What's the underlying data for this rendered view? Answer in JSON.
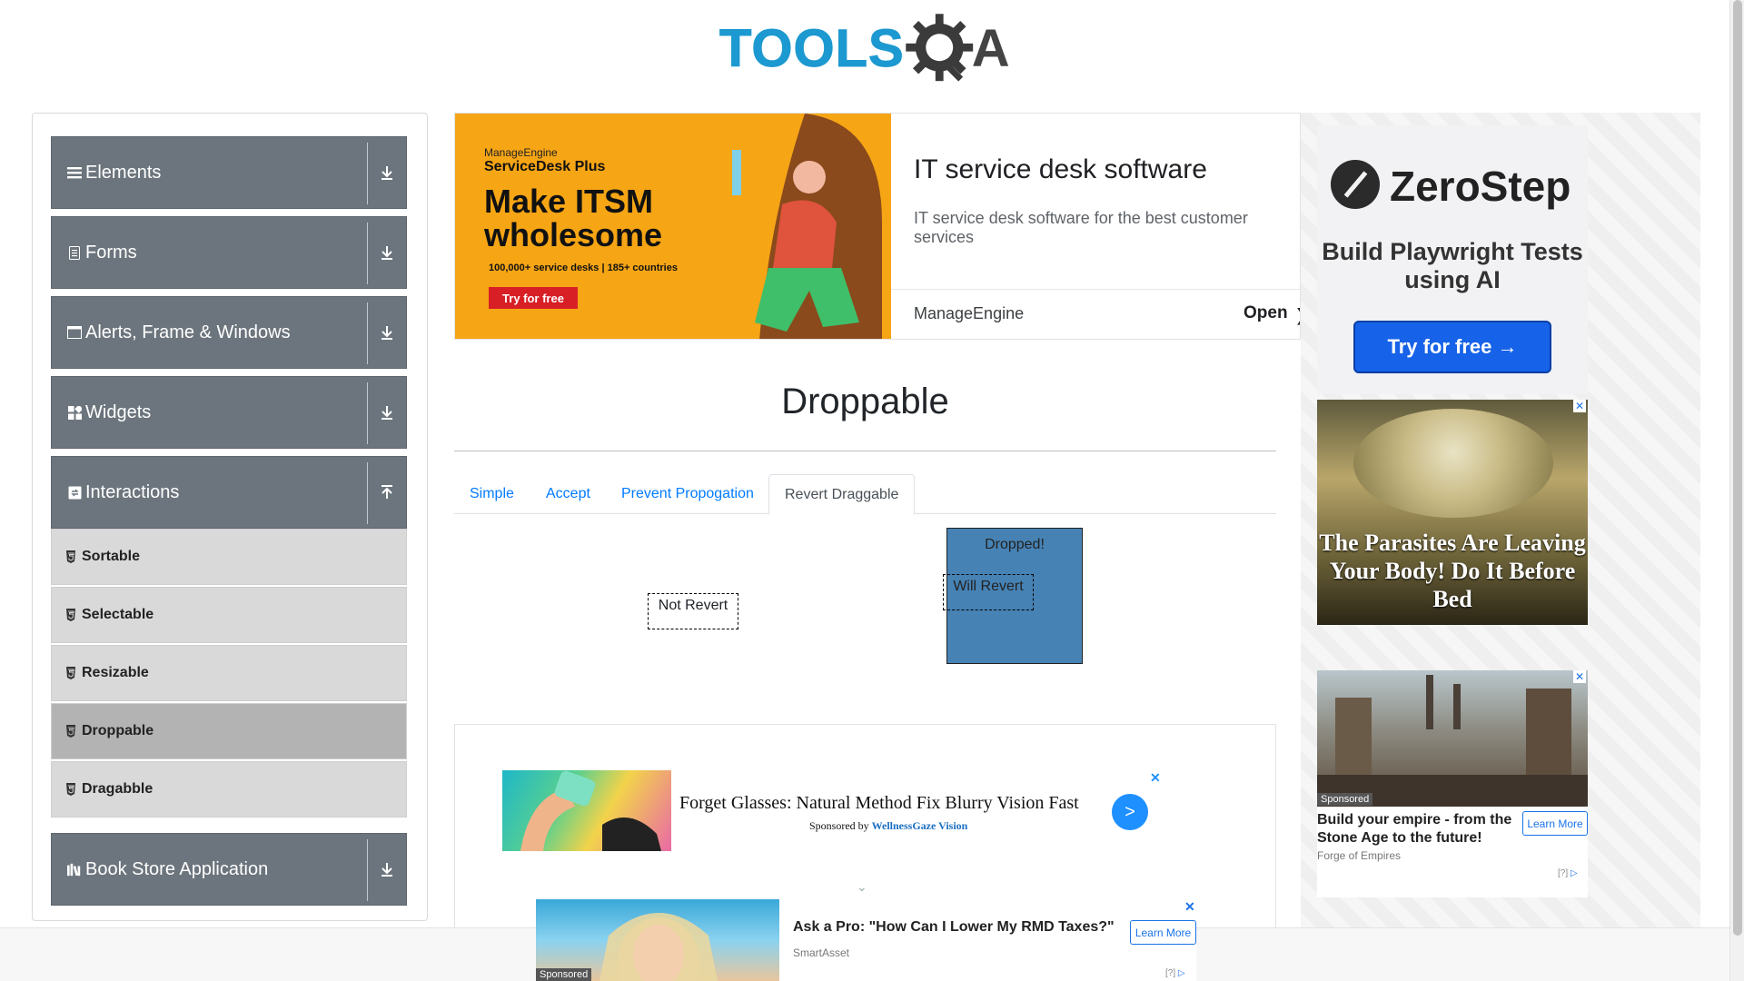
{
  "header": {
    "logo_text_tools": "TOOLS",
    "logo_text_qa": "A"
  },
  "sidebar": {
    "groups": [
      {
        "label": "Elements",
        "icon": "hamburger-icon"
      },
      {
        "label": "Forms",
        "icon": "document-icon"
      },
      {
        "label": "Alerts, Frame & Windows",
        "icon": "window-icon"
      },
      {
        "label": "Widgets",
        "icon": "widgets-icon"
      },
      {
        "label": "Interactions",
        "icon": "interactions-icon",
        "expanded": true
      },
      {
        "label": "Book Store Application",
        "icon": "books-icon"
      }
    ],
    "interaction_items": [
      "Sortable",
      "Selectable",
      "Resizable",
      "Droppable",
      "Dragabble"
    ],
    "active_item": "Droppable"
  },
  "ad_top": {
    "brand_small": "ManageEngine",
    "product": "ServiceDesk Plus",
    "headline": "Make ITSM wholesome",
    "count": "100,000+ service desks | 185+ countries",
    "cta": "Try for free",
    "title": "IT service desk software",
    "desc": "IT service desk software for the best customer services",
    "advertiser": "ManageEngine",
    "open": "Open"
  },
  "main": {
    "title": "Droppable",
    "tabs": [
      "Simple",
      "Accept",
      "Prevent Propogation",
      "Revert Draggable"
    ],
    "active_tab": "Revert Draggable",
    "not_revert": "Not Revert",
    "will_revert": "Will Revert",
    "drop_text": "Dropped!"
  },
  "native_ad": {
    "title": "Forget Glasses: Natural Method Fix Blurry Vision Fast",
    "sponsored_prefix": "Sponsored by",
    "sponsor": "WellnessGaze Vision",
    "go": ">",
    "close": "✕"
  },
  "sticky_ad": {
    "sponsored": "Sponsored",
    "headline": "Ask a Pro: \"How Can I Lower My RMD Taxes?\"",
    "advertiser": "SmartAsset",
    "cta": "Learn More",
    "close": "✕",
    "q": "[?]"
  },
  "right_ads": {
    "zerostep": {
      "brand": "ZeroStep",
      "tagline": "Build Playwright Tests using AI",
      "cta": "Try for free →"
    },
    "parasites": {
      "text": "The Parasites Are Leaving Your Body! Do It Before Bed",
      "close": "✕"
    },
    "foe": {
      "sponsored": "Sponsored",
      "headline": "Build your empire - from the Stone Age to the future!",
      "advertiser": "Forge of Empires",
      "cta": "Learn More",
      "close": "✕",
      "q": "[?]"
    }
  },
  "colors": {
    "sidebar_group": "#6c757d",
    "drop_box": "#4682b4",
    "link": "#007bff",
    "logo_blue": "#1c99d0"
  }
}
